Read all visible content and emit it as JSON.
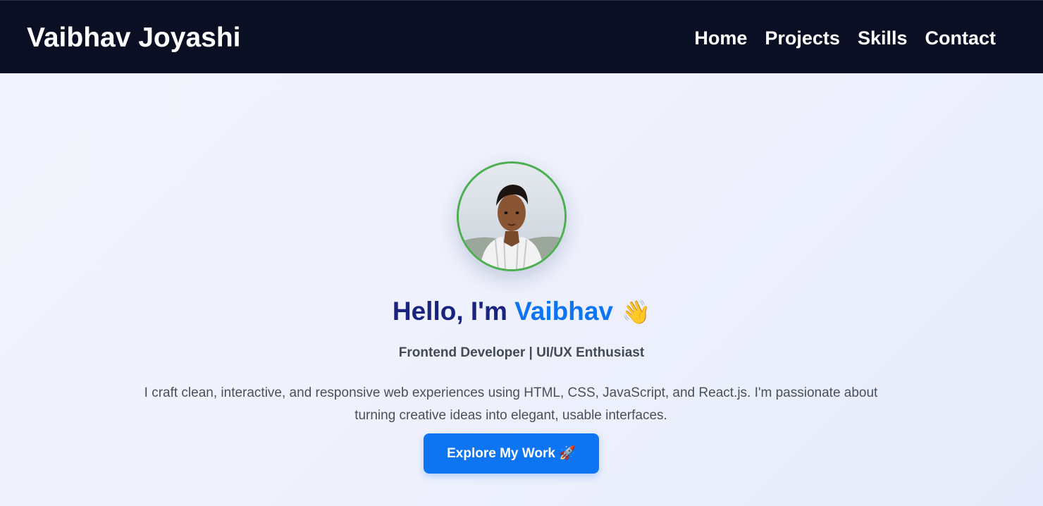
{
  "navbar": {
    "brand": "Vaibhav Joyashi",
    "links": [
      "Home",
      "Projects",
      "Skills",
      "Contact"
    ]
  },
  "hero": {
    "greeting_prefix": "Hello, I'm ",
    "greeting_name": "Vaibhav",
    "greeting_emoji": "👋",
    "subtitle": "Frontend Developer | UI/UX Enthusiast",
    "description": "I craft clean, interactive, and responsive web experiences using HTML, CSS, JavaScript, and React.js. I'm passionate about turning creative ideas into elegant, usable interfaces.",
    "cta_label": "Explore My Work 🚀",
    "avatar_icon": "profile-photo"
  },
  "colors": {
    "navbar_bg": "#0a0f24",
    "accent": "#0d74f2",
    "greeting": "#1b2380",
    "avatar_border": "#4caf50"
  }
}
